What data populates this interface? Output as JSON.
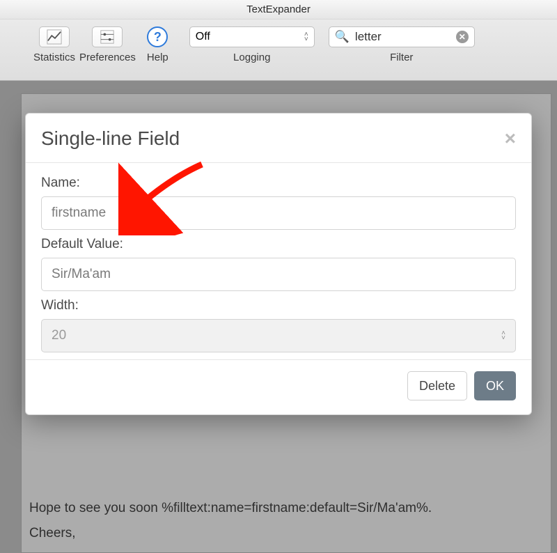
{
  "window": {
    "title": "TextExpander"
  },
  "toolbar": {
    "statistics": "Statistics",
    "preferences": "Preferences",
    "help": "Help",
    "logging": {
      "label": "Logging",
      "value": "Off"
    },
    "filter": {
      "label": "Filter",
      "value": "letter"
    }
  },
  "editor": {
    "line1": "Hope to see you soon %filltext:name=firstname:default=Sir/Ma'am%.",
    "line2": "Cheers,"
  },
  "dialog": {
    "title": "Single-line Field",
    "name_label": "Name:",
    "name_value": "firstname",
    "default_label": "Default Value:",
    "default_value": "Sir/Ma'am",
    "width_label": "Width:",
    "width_value": "20",
    "delete": "Delete",
    "ok": "OK"
  },
  "icons": {
    "help_glyph": "?",
    "search_glyph": "🔍",
    "clear_glyph": "✕",
    "close_glyph": "×",
    "chev_up": "˄",
    "chev_down": "˅"
  }
}
